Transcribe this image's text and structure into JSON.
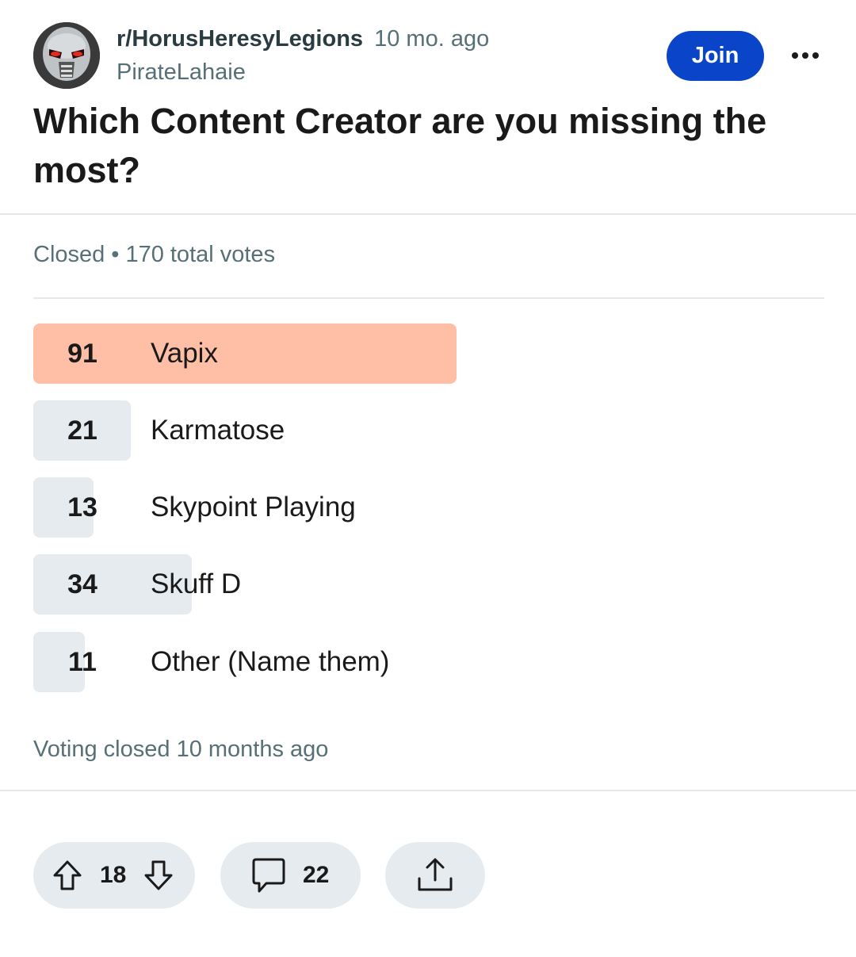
{
  "post": {
    "subreddit": "r/HorusHeresyLegions",
    "age": "10 mo. ago",
    "author": "PirateLahaie",
    "join_label": "Join",
    "title": "Which Content Creator are you missing the most?"
  },
  "poll": {
    "status": "Closed",
    "separator": "•",
    "total_votes": "170 total votes",
    "options": [
      {
        "label": "Vapix",
        "votes": "91",
        "winner": true
      },
      {
        "label": "Karmatose",
        "votes": "21",
        "winner": false
      },
      {
        "label": "Skypoint Playing",
        "votes": "13",
        "winner": false
      },
      {
        "label": "Skuff D",
        "votes": "34",
        "winner": false
      },
      {
        "label": "Other (Name them)",
        "votes": "11",
        "winner": false
      }
    ],
    "closed_note": "Voting closed 10 months ago"
  },
  "actions": {
    "upvotes": "18",
    "comments": "22"
  },
  "colors": {
    "join_button": "#0a45c9",
    "winner_bar": "#ffbea6",
    "option_bar": "#e5ebee",
    "muted_text": "#576f76"
  },
  "icons": [
    "avatar-image",
    "more-icon",
    "upvote-icon",
    "downvote-icon",
    "comment-icon",
    "share-icon"
  ]
}
